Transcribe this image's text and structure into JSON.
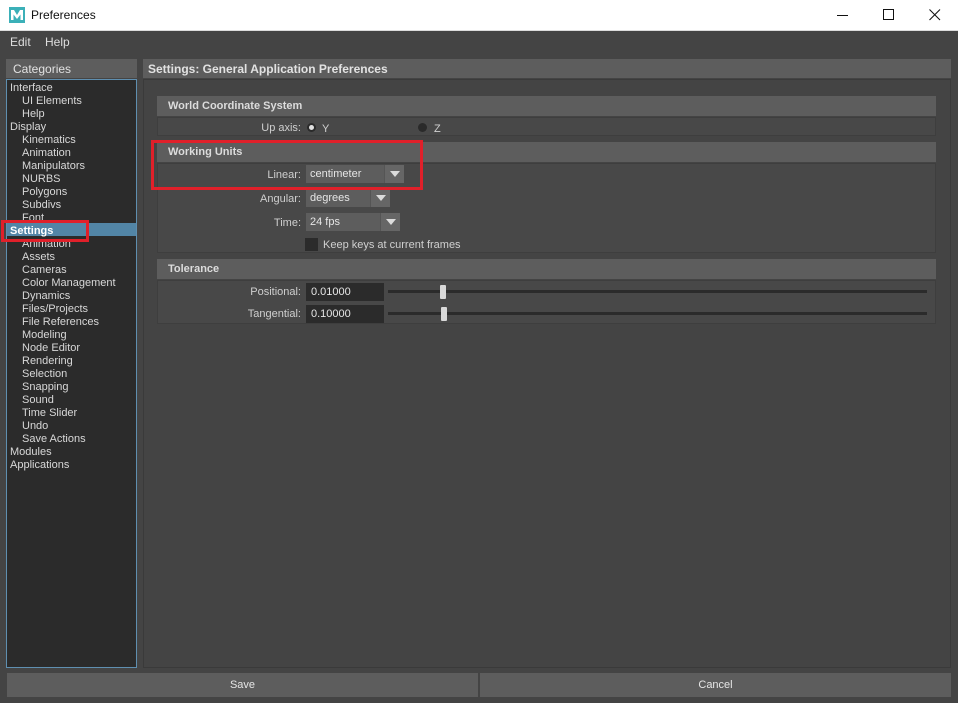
{
  "window": {
    "title": "Preferences",
    "app_icon_letter": "M",
    "controls": [
      "minimize-icon",
      "maximize-icon",
      "close-icon"
    ]
  },
  "menu": {
    "edit": "Edit",
    "help": "Help"
  },
  "categories": {
    "header": "Categories",
    "items": [
      {
        "label": "Interface",
        "level": 0
      },
      {
        "label": "UI Elements",
        "level": 1
      },
      {
        "label": "Help",
        "level": 1
      },
      {
        "label": "Display",
        "level": 0
      },
      {
        "label": "Kinematics",
        "level": 1
      },
      {
        "label": "Animation",
        "level": 1
      },
      {
        "label": "Manipulators",
        "level": 1
      },
      {
        "label": "NURBS",
        "level": 1
      },
      {
        "label": "Polygons",
        "level": 1
      },
      {
        "label": "Subdivs",
        "level": 1
      },
      {
        "label": "Font",
        "level": 1
      },
      {
        "label": "Settings",
        "level": 0,
        "selected": true
      },
      {
        "label": "Animation",
        "level": 1
      },
      {
        "label": "Assets",
        "level": 1
      },
      {
        "label": "Cameras",
        "level": 1
      },
      {
        "label": "Color Management",
        "level": 1
      },
      {
        "label": "Dynamics",
        "level": 1
      },
      {
        "label": "Files/Projects",
        "level": 1
      },
      {
        "label": "File References",
        "level": 1
      },
      {
        "label": "Modeling",
        "level": 1
      },
      {
        "label": "Node Editor",
        "level": 1
      },
      {
        "label": "Rendering",
        "level": 1
      },
      {
        "label": "Selection",
        "level": 1
      },
      {
        "label": "Snapping",
        "level": 1
      },
      {
        "label": "Sound",
        "level": 1
      },
      {
        "label": "Time Slider",
        "level": 1
      },
      {
        "label": "Undo",
        "level": 1
      },
      {
        "label": "Save Actions",
        "level": 1
      },
      {
        "label": "Modules",
        "level": 0
      },
      {
        "label": "Applications",
        "level": 0
      }
    ]
  },
  "settings": {
    "header": "Settings: General Application Preferences",
    "world": {
      "title": "World Coordinate System",
      "up_axis_label": "Up axis:",
      "options": [
        "Y",
        "Z"
      ],
      "selected": "Y"
    },
    "working_units": {
      "title": "Working Units",
      "linear_label": "Linear:",
      "linear_value": "centimeter",
      "angular_label": "Angular:",
      "angular_value": "degrees",
      "time_label": "Time:",
      "time_value": "24 fps",
      "keep_keys_label": "Keep keys at current frames",
      "keep_keys_checked": false
    },
    "tolerance": {
      "title": "Tolerance",
      "positional_label": "Positional:",
      "positional_value": "0.01000",
      "positional_slider": 0.1,
      "tangential_label": "Tangential:",
      "tangential_value": "0.10000",
      "tangential_slider": 0.1
    }
  },
  "buttons": {
    "save": "Save",
    "cancel": "Cancel"
  },
  "colors": {
    "background": "#444444",
    "panel_header": "#5d5d5d",
    "list_bg": "#2b2b2b",
    "selection": "#5285a6",
    "highlight_box": "#e0202a",
    "app_icon": "#3bb0b8"
  }
}
